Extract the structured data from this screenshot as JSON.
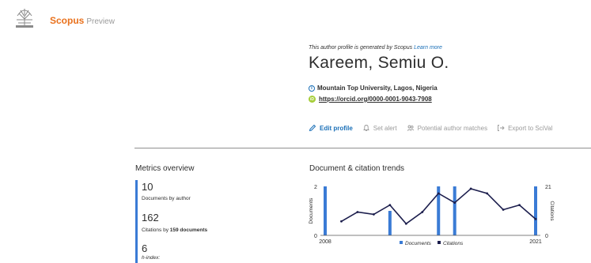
{
  "header": {
    "brand": "Scopus",
    "brand_suffix": "Preview",
    "logo_icon": "elsevier-tree-logo",
    "brand_color": "#e9711c"
  },
  "profile": {
    "notice_text": "This author profile is generated by Scopus",
    "learn_more": "Learn more",
    "name": "Kareem, Semiu O.",
    "affiliation": "Mountain Top University, Lagos, Nigeria",
    "orcid_url": "https://orcid.org/0000-0001-9043-7908",
    "accent_color": "#1a6fb7"
  },
  "actions": [
    {
      "label": "Edit profile",
      "icon": "pencil-icon",
      "enabled": true
    },
    {
      "label": "Set alert",
      "icon": "bell-icon",
      "enabled": false
    },
    {
      "label": "Potential author matches",
      "icon": "people-icon",
      "enabled": false
    },
    {
      "label": "Export to SciVal",
      "icon": "export-icon",
      "enabled": false
    }
  ],
  "metrics": {
    "title": "Metrics overview",
    "documents_value": "10",
    "documents_label": "Documents by author",
    "citations_value": "162",
    "citations_label_prefix": "Citations by",
    "citations_label_count": "159 documents",
    "hindex_value": "6",
    "hindex_label": "h-index:"
  },
  "chart_data": {
    "type": "bar",
    "title": "Document & citation trends",
    "x": [
      2008,
      2009,
      2010,
      2011,
      2012,
      2013,
      2014,
      2015,
      2016,
      2017,
      2018,
      2019,
      2020,
      2021
    ],
    "x_tick_labels": [
      "2008",
      "2021"
    ],
    "series": [
      {
        "name": "Documents",
        "type": "bar",
        "axis": "left",
        "color": "#3a7bd5",
        "values": [
          2,
          0,
          0,
          0,
          1,
          0,
          0,
          2,
          2,
          0,
          0,
          0,
          0,
          2
        ]
      },
      {
        "name": "Citations",
        "type": "line",
        "axis": "left",
        "color": "#1c1e4d",
        "values": [
          null,
          6,
          10,
          9,
          13,
          5,
          10,
          18,
          14,
          20,
          18,
          11,
          13,
          7
        ]
      }
    ],
    "series_axis_override": {
      "Documents": "left",
      "Citations": "right"
    },
    "ylabel": "Documents",
    "ylim": [
      0,
      2
    ],
    "y_ticks": [
      "0",
      "2"
    ],
    "y2label": "Citations",
    "y2lim": [
      0,
      21
    ],
    "y2_ticks": [
      "0",
      "21"
    ],
    "legend": "bottom",
    "grid": false
  }
}
